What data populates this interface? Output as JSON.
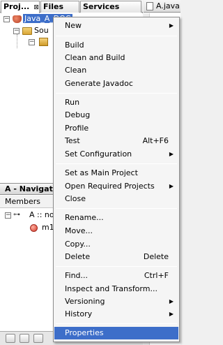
{
  "projects_panel": {
    "tabs": [
      "Proj...",
      "Files",
      "Services"
    ],
    "tab_close": "⊠",
    "tree": {
      "root_label": "Java_A_DOC",
      "child_label": "Sou"
    }
  },
  "navigator": {
    "title": "A - Navigator",
    "filter_label": "Members",
    "class_node": "A :: no",
    "member_node": "m1"
  },
  "editor": {
    "tab_label": "A.java"
  },
  "context_menu": {
    "items": [
      {
        "label": "New",
        "submenu": true
      },
      {
        "label": "Build"
      },
      {
        "label": "Clean and Build"
      },
      {
        "label": "Clean"
      },
      {
        "label": "Generate Javadoc"
      },
      {
        "label": "Run"
      },
      {
        "label": "Debug"
      },
      {
        "label": "Profile"
      },
      {
        "label": "Test",
        "shortcut": "Alt+F6"
      },
      {
        "label": "Set Configuration",
        "submenu": true
      },
      {
        "label": "Set as Main Project"
      },
      {
        "label": "Open Required Projects",
        "submenu": true
      },
      {
        "label": "Close"
      },
      {
        "label": "Rename..."
      },
      {
        "label": "Move..."
      },
      {
        "label": "Copy..."
      },
      {
        "label": "Delete",
        "shortcut": "Delete"
      },
      {
        "label": "Find...",
        "shortcut": "Ctrl+F"
      },
      {
        "label": "Inspect and Transform..."
      },
      {
        "label": "Versioning",
        "submenu": true
      },
      {
        "label": "History",
        "submenu": true
      },
      {
        "label": "Properties",
        "highlighted": true
      }
    ]
  },
  "colors": {
    "selection": "#3d6ec9",
    "menu_bg": "#f5f5f5"
  }
}
